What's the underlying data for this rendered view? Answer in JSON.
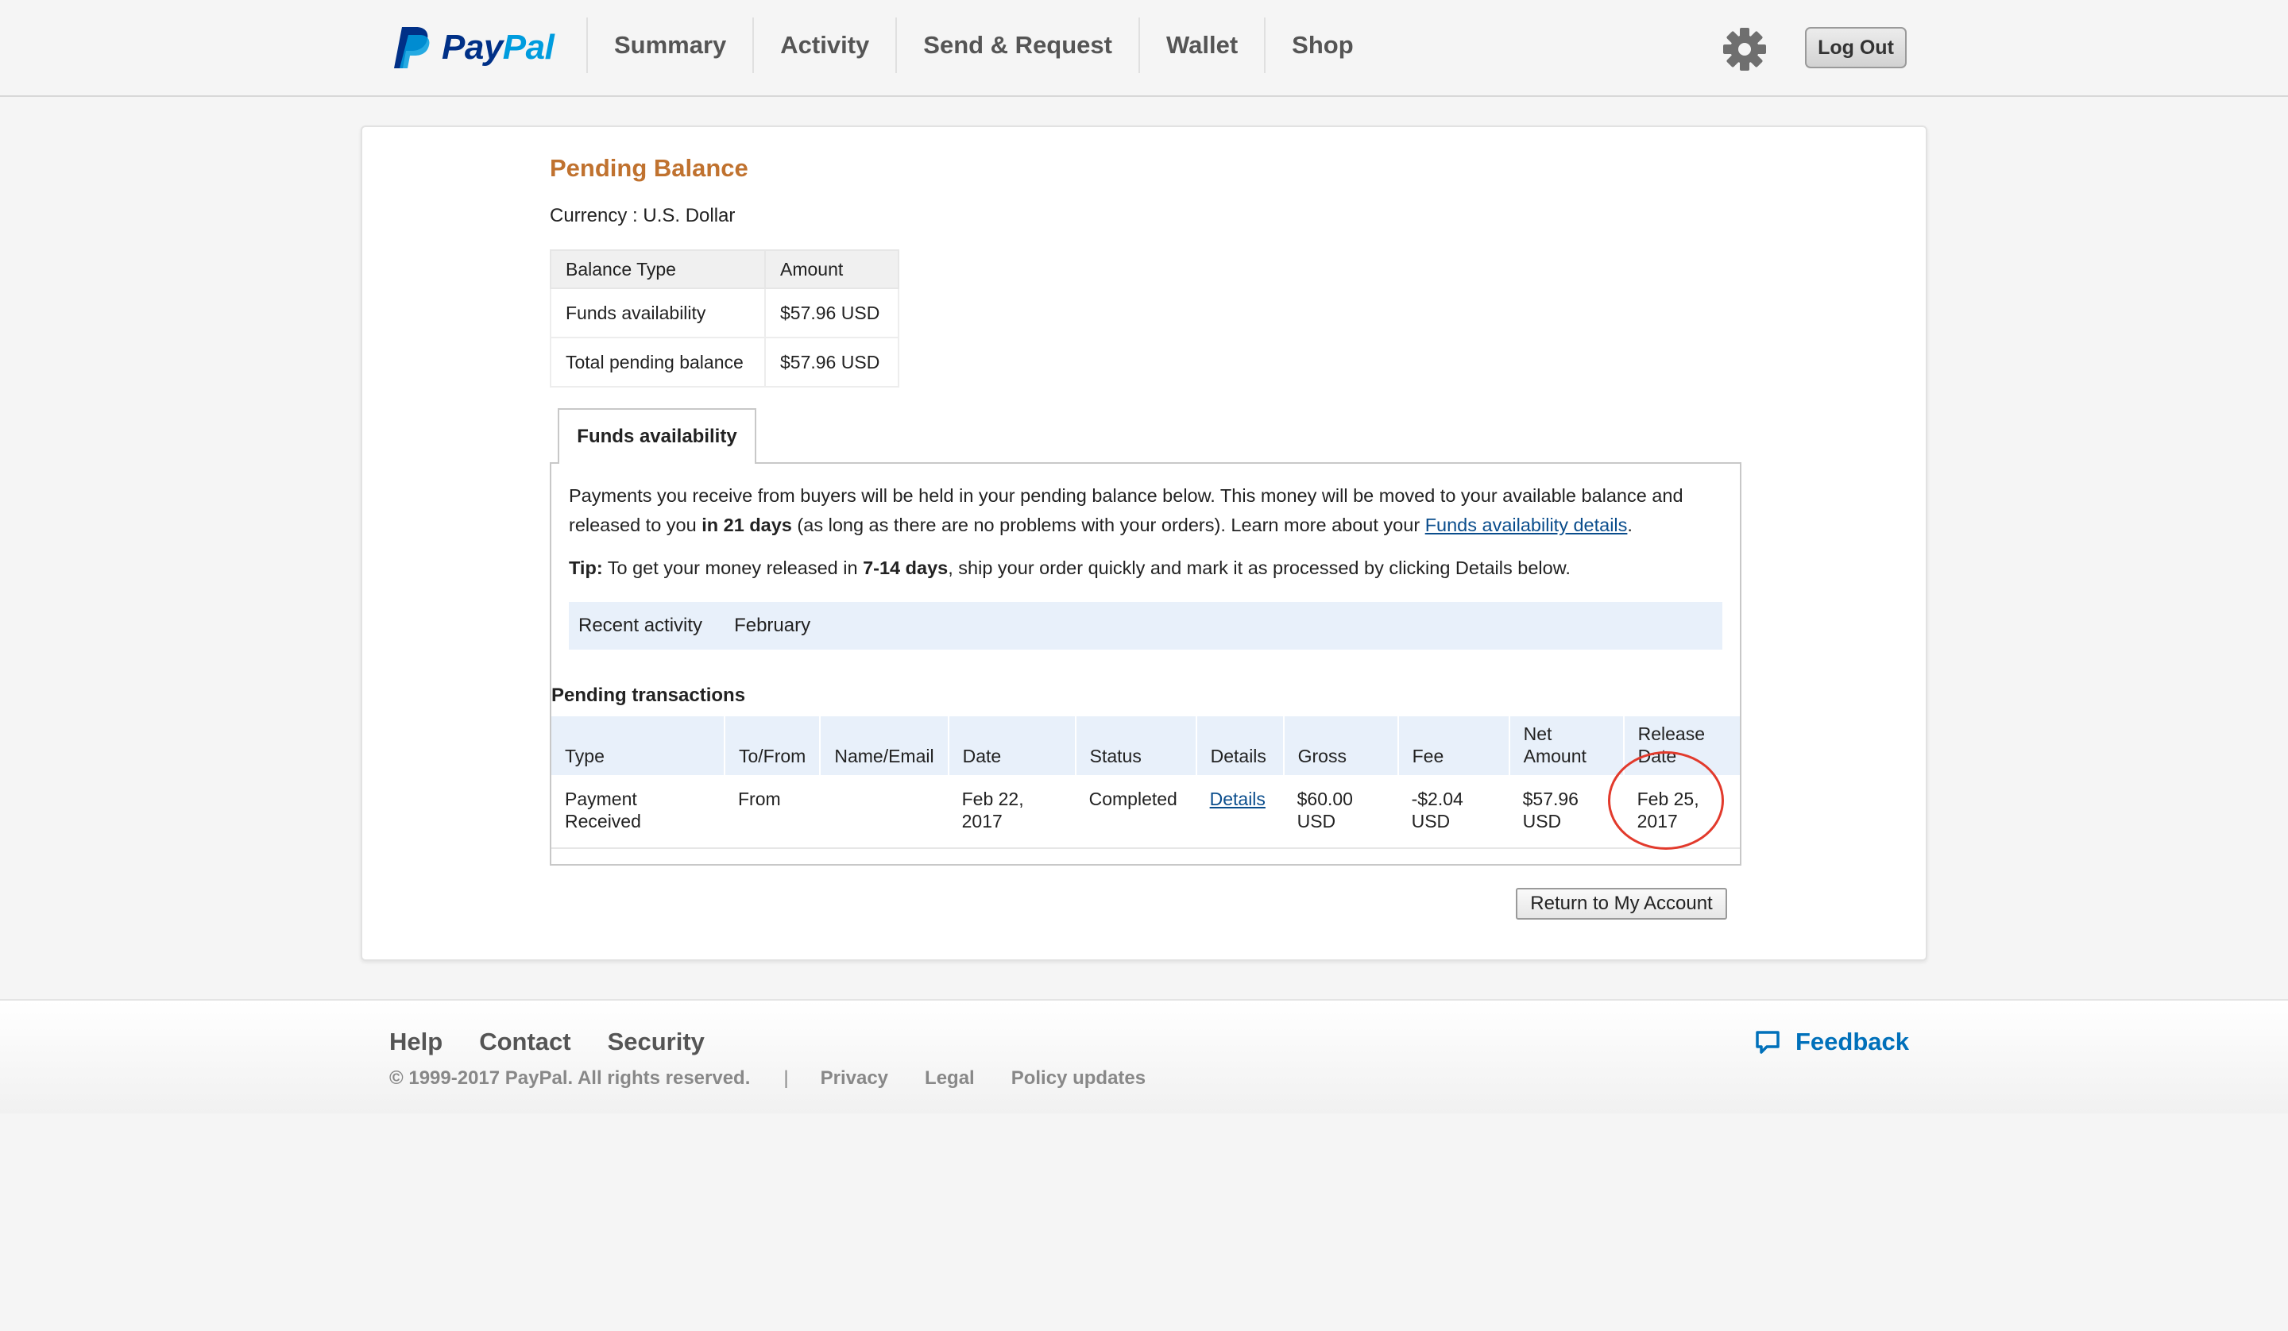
{
  "brand": {
    "name_part1": "Pay",
    "name_part2": "Pal",
    "colors": {
      "dark_blue": "#003087",
      "light_blue": "#009cde",
      "title_orange": "#c0722f",
      "link_blue": "#0a4d8c",
      "feedback_blue": "#0070ba",
      "highlight_red": "#e23a2c"
    }
  },
  "nav": {
    "items": [
      "Summary",
      "Activity",
      "Send & Request",
      "Wallet",
      "Shop"
    ],
    "settings_icon": "gear-icon",
    "logout_label": "Log Out"
  },
  "page": {
    "title": "Pending Balance",
    "currency": "Currency : U.S. Dollar",
    "balance_table": {
      "headers": [
        "Balance Type",
        "Amount"
      ],
      "rows": [
        [
          "Funds availability",
          "$57.96 USD"
        ],
        [
          "Total pending balance",
          "$57.96 USD"
        ]
      ]
    },
    "tab_label": "Funds availability",
    "info": {
      "part1": "Payments you receive from buyers will be held in your pending balance below. This money will be moved to your available balance and released to you ",
      "days": "in 21 days",
      "part2": " (as long as there are no problems with your orders). Learn more about your ",
      "link": "Funds availability details",
      "end": "."
    },
    "tip": {
      "label": "Tip:",
      "part1": " To get your money released in ",
      "days": "7-14 days",
      "part2": ", ship your order quickly and mark it as processed by clicking Details below."
    },
    "recent_activity": {
      "label": "Recent activity",
      "value": "February"
    },
    "pending_title": "Pending transactions",
    "tx_table": {
      "headers": [
        "Type",
        "To/From",
        "Name/Email",
        "Date",
        "Status",
        "Details",
        "Gross",
        "Fee",
        "Net Amount",
        "Release Date"
      ],
      "rows": [
        {
          "type": "Payment Received",
          "to_from": "From",
          "name_email": "",
          "date": "Feb 22, 2017",
          "status": "Completed",
          "details": "Details",
          "gross": "$60.00 USD",
          "fee": "-$2.04 USD",
          "net": "$57.96 USD",
          "release": "Feb 25, 2017"
        }
      ]
    },
    "return_button": "Return to My Account"
  },
  "footer": {
    "links": [
      "Help",
      "Contact",
      "Security"
    ],
    "copyright": "© 1999-2017 PayPal. All rights reserved.",
    "separator": "|",
    "legal_links": [
      "Privacy",
      "Legal",
      "Policy updates"
    ],
    "feedback": "Feedback",
    "feedback_icon": "chat-bubble-icon"
  }
}
